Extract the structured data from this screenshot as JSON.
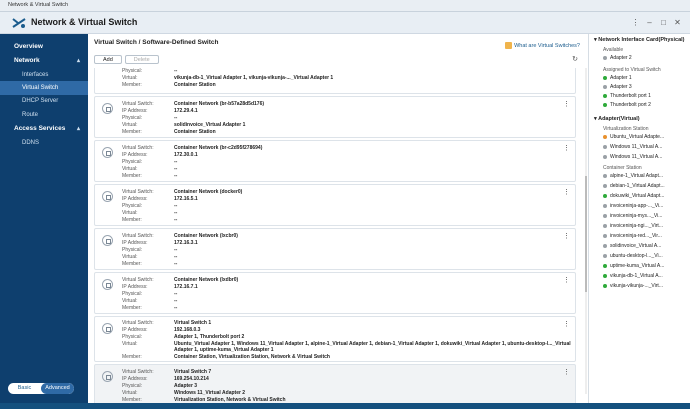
{
  "window": {
    "title": "Network & Virtual Switch"
  },
  "app": {
    "title": "Network & Virtual Switch"
  },
  "sidebar": {
    "items": [
      {
        "label": "Overview"
      },
      {
        "label": "Network"
      },
      {
        "label": "Interfaces"
      },
      {
        "label": "Virtual Switch"
      },
      {
        "label": "DHCP Server"
      },
      {
        "label": "Route"
      },
      {
        "label": "Access Services"
      },
      {
        "label": "DDNS"
      }
    ],
    "mode": {
      "basic": "Basic",
      "advanced": "Advanced"
    }
  },
  "main": {
    "heading": "Virtual Switch / Software-Defined Switch",
    "help": "What are Virtual Switches?",
    "toolbar": {
      "add": "Add",
      "delete": "Delete"
    },
    "labels": {
      "vs": "Virtual Switch:",
      "ip": "IP Address:",
      "phys": "Physical:",
      "virt": "Virtual:",
      "member": "Member:"
    },
    "cards": [
      {
        "vs": "",
        "ip": "",
        "phys": "--",
        "virt": "vikunja-db-1_Virtual Adapter 1, vikunja-vikunja-..._Virtual Adapter 1",
        "member": "Container Station"
      },
      {
        "vs": "Container Network (br-b57a28d5d176)",
        "ip": "172.29.4.1",
        "phys": "--",
        "virt": "solidinvoice_Virtual Adapter 1",
        "member": "Container Station"
      },
      {
        "vs": "Container Network (br-c2d95f278694)",
        "ip": "172.30.0.1",
        "phys": "--",
        "virt": "--",
        "member": "--"
      },
      {
        "vs": "Container Network (docker0)",
        "ip": "172.16.5.1",
        "phys": "--",
        "virt": "--",
        "member": "--"
      },
      {
        "vs": "Container Network (lxcbr0)",
        "ip": "172.16.3.1",
        "phys": "--",
        "virt": "--",
        "member": "--"
      },
      {
        "vs": "Container Network (lxdbr0)",
        "ip": "172.16.7.1",
        "phys": "--",
        "virt": "--",
        "member": "--"
      },
      {
        "vs": "Virtual Switch 1",
        "ip": "192.168.0.3",
        "phys": "Adapter 1, Thunderbolt port 2",
        "virt": "Ubuntu_Virtual Adapter 1, Windows 11_Virtual Adapter 1, alpine-1_Virtual Adapter 1, debian-1_Virtual Adapter 1, dokuwiki_Virtual Adapter 1, ubuntu-desktop-l..._Virtual",
        "virt2": "Adapter 1, uptime-kuma_Virtual Adapter 1",
        "member": "Container Station, Virtualization Station, Network & Virtual Switch"
      },
      {
        "vs": "Virtual Switch 7",
        "ip": "169.254.10.214",
        "phys": "Adapter 3",
        "virt": "Windows 11_Virtual Adapter 2",
        "member": "Virtualization Station, Network & Virtual Switch"
      }
    ]
  },
  "right_panel": {
    "nic_title": "Network Interface Card(Physical)",
    "available_label": "Available",
    "available": [
      {
        "label": "Adapter 2",
        "color": "#9aa0a6"
      }
    ],
    "assigned_label": "Assigned to Virtual Switch",
    "assigned": [
      {
        "label": "Adapter 1",
        "color": "#2eaa3a"
      },
      {
        "label": "Adapter 3",
        "color": "#9aa0a6"
      },
      {
        "label": "Thunderbolt port 1",
        "color": "#2eaa3a"
      },
      {
        "label": "Thunderbolt port 2",
        "color": "#2eaa3a"
      }
    ],
    "virt_title": "Adapter(Virtual)",
    "vs_station_label": "Virtualization Station",
    "vs_station": [
      {
        "label": "Ubuntu_Virtual Adapte...",
        "color": "#e8912d"
      },
      {
        "label": "Windows 11_Virtual A...",
        "color": "#9aa0a6"
      },
      {
        "label": "Windows 11_Virtual A...",
        "color": "#9aa0a6"
      }
    ],
    "container_label": "Container Station",
    "container": [
      {
        "label": "alpine-1_Virtual Adapt...",
        "color": "#9aa0a6"
      },
      {
        "label": "debian-1_Virtual Adapt...",
        "color": "#9aa0a6"
      },
      {
        "label": "dokuwiki_Virtual Adapt...",
        "color": "#2eaa3a"
      },
      {
        "label": "invoiceninja-app-..._Vi...",
        "color": "#9aa0a6"
      },
      {
        "label": "invoiceninja-mys..._Vi...",
        "color": "#9aa0a6"
      },
      {
        "label": "invoiceninja-ngi..._Virt...",
        "color": "#9aa0a6"
      },
      {
        "label": "invoiceninja-red..._Vir...",
        "color": "#9aa0a6"
      },
      {
        "label": "solidinvoice_Virtual A...",
        "color": "#9aa0a6"
      },
      {
        "label": "ubuntu-desktop-l..._Vi...",
        "color": "#9aa0a6"
      },
      {
        "label": "uptime-kuma_Virtual A...",
        "color": "#2eaa3a"
      },
      {
        "label": "vikunja-db-1_Virtual A...",
        "color": "#2eaa3a"
      },
      {
        "label": "vikunja-vikunja-..._Virt...",
        "color": "#2eaa3a"
      }
    ]
  }
}
